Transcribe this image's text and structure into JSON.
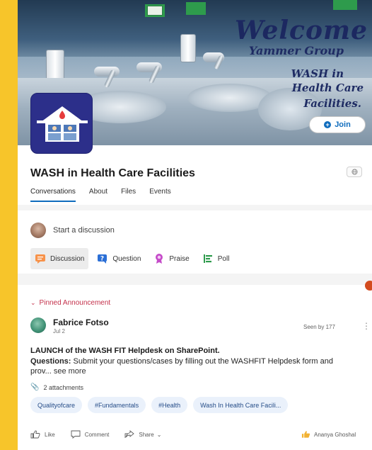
{
  "banner": {
    "welcome": "Welcome",
    "subtitle": "Yammer Group",
    "line1": "WASH in",
    "line2": "Health Care",
    "line3": "Facilities."
  },
  "group": {
    "join_label": "Join",
    "title": "WASH in Health Care Facilities",
    "tabs": [
      {
        "label": "Conversations",
        "active": true
      },
      {
        "label": "About"
      },
      {
        "label": "Files"
      },
      {
        "label": "Events"
      }
    ]
  },
  "composer": {
    "placeholder": "Start a discussion",
    "post_types": [
      {
        "label": "Discussion",
        "icon": "discussion-icon",
        "selected": true
      },
      {
        "label": "Question",
        "icon": "question-icon"
      },
      {
        "label": "Praise",
        "icon": "praise-icon"
      },
      {
        "label": "Poll",
        "icon": "poll-icon"
      }
    ]
  },
  "post": {
    "pinned_label": "Pinned Announcement",
    "author": "Fabrice Fotso",
    "date": "Jul 2",
    "seen_by": "Seen by 177",
    "headline": "LAUNCH of the WASH FIT Helpdesk on SharePoint.",
    "body_label": "Questions:",
    "body_text": " Submit your questions/cases by filling out the WASHFIT Helpdesk form and prov...",
    "see_more": " see more",
    "attachments": "2 attachments",
    "tags": [
      "Qualityofcare",
      "#Fundamentals",
      "#Health",
      "Wash In Health Care Facili..."
    ],
    "actions": {
      "like": "Like",
      "comment": "Comment",
      "share": "Share"
    },
    "liked_by": "Ananya Ghoshal"
  },
  "colors": {
    "page_background": "#f7c52a",
    "accent": "#0f6cbd",
    "pinned": "#c4314b",
    "tag_background": "#eaf1fb",
    "banner_text": "#1e2b63"
  }
}
